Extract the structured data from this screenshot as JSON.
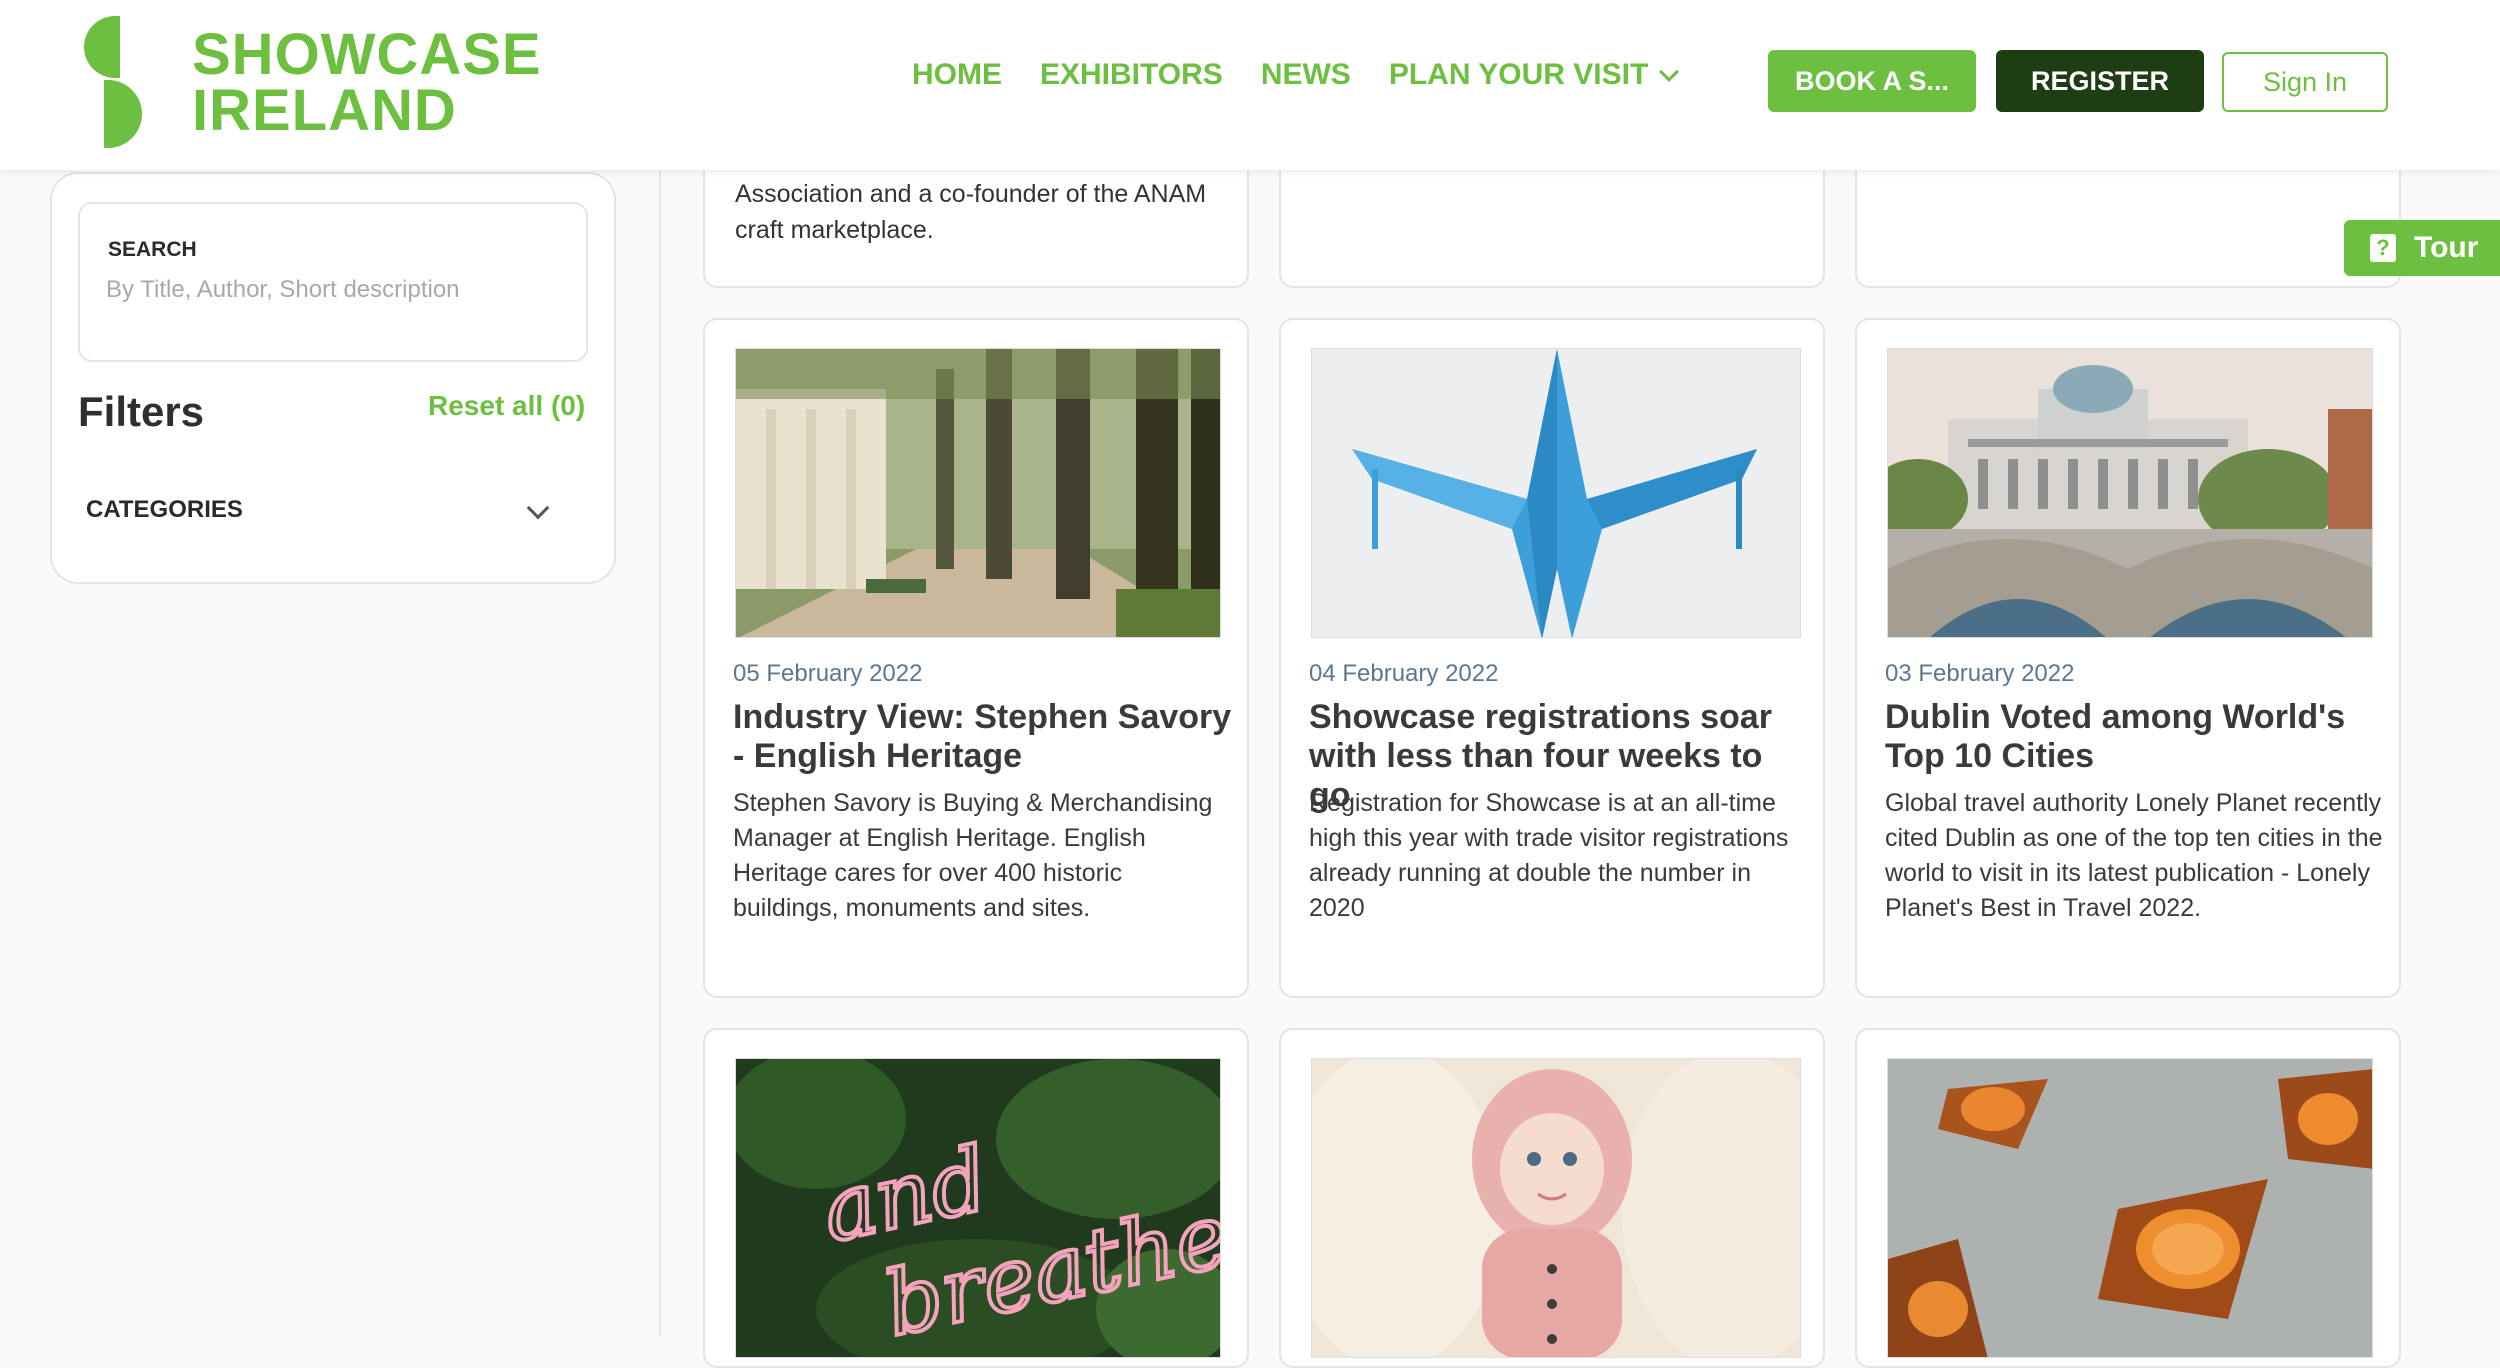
{
  "header": {
    "logo_line1": "SHOWCASE",
    "logo_line2": "IRELAND",
    "nav": [
      {
        "label": "HOME"
      },
      {
        "label": "EXHIBITORS"
      },
      {
        "label": "NEWS"
      },
      {
        "label": "PLAN YOUR VISIT"
      }
    ],
    "book_label": "BOOK A S...",
    "register_label": "REGISTER",
    "signin_label": "Sign In"
  },
  "tour": {
    "label": "Tour",
    "icon": "question-icon"
  },
  "sidebar": {
    "search_label": "SEARCH",
    "search_placeholder": "By Title, Author, Short description",
    "search_value": "",
    "filters_title": "Filters",
    "reset_label": "Reset all (0)",
    "categories_label": "CATEGORIES"
  },
  "articles_partial_top": [
    {
      "text": "Association and a co-founder of the ANAM craft marketplace."
    }
  ],
  "articles": [
    {
      "date": "05 February 2022",
      "title": "Industry View: Stephen Savory - English Heritage",
      "description": "Stephen Savory is Buying & Merchandising Manager at English Heritage. English Heritage cares for over 400 historic buildings, monuments and sites.",
      "image": "tree-lined-avenue"
    },
    {
      "date": "04 February 2022",
      "title": "Showcase registrations soar with less than four weeks to go",
      "description": "Registration for Showcase is at an all-time high this year with trade visitor registrations already running at double the number in 2020",
      "image": "blue-paper-plane"
    },
    {
      "date": "03 February 2022",
      "title": "Dublin Voted among World's Top 10 Cities",
      "description": "Global travel authority Lonely Planet recently cited Dublin as one of the top ten cities in the world to visit in its latest publication - Lonely Planet's Best in Travel 2022.",
      "image": "dublin-four-courts-bridge"
    }
  ],
  "bottom_row": [
    {
      "image": "neon-and-breathe-sign",
      "neon_text_1": "and",
      "neon_text_2": "breathe"
    },
    {
      "image": "baby-pink-knit"
    },
    {
      "image": "orange-pastries"
    }
  ],
  "colors": {
    "brand_green": "#6cbf3f",
    "dark_green": "#1f3d13",
    "date_blue": "#5b7792"
  }
}
